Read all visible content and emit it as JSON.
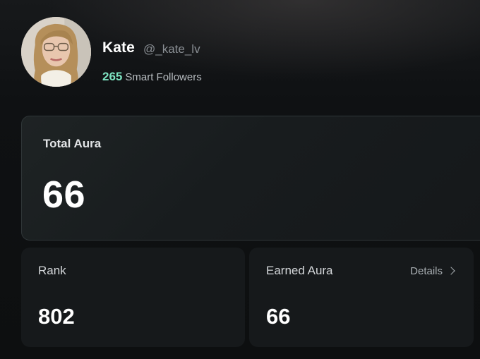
{
  "profile": {
    "name": "Kate",
    "handle": "@_kate_lv",
    "smart_followers_count": "265",
    "smart_followers_label": "Smart Followers"
  },
  "total_aura": {
    "label": "Total Aura",
    "value": "66"
  },
  "rank": {
    "label": "Rank",
    "value": "802"
  },
  "earned_aura": {
    "label": "Earned Aura",
    "value": "66",
    "details_label": "Details",
    "details_icon": "chevron-right-icon"
  },
  "colors": {
    "background": "#0f1113",
    "accent": "#7de3c1",
    "card": "#16191b"
  }
}
